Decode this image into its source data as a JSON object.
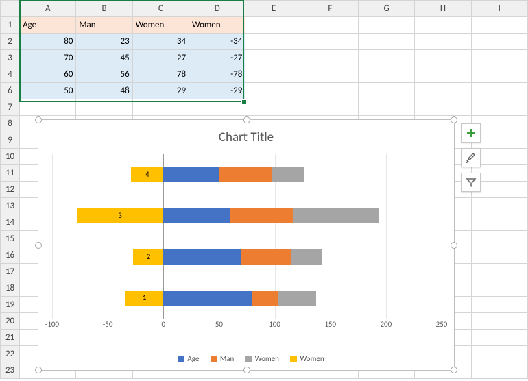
{
  "columns": [
    "A",
    "B",
    "C",
    "D",
    "E",
    "F",
    "G",
    "H",
    "I"
  ],
  "visible_rows": [
    "1",
    "2",
    "3",
    "4",
    "6",
    "7",
    "8",
    "9",
    "10",
    "11",
    "12",
    "13",
    "14",
    "15",
    "16",
    "17",
    "18",
    "19",
    "20",
    "21",
    "22",
    "23"
  ],
  "table": {
    "headers": [
      "Age",
      "Man",
      "Women",
      "Women"
    ],
    "rows": [
      {
        "r": "2",
        "v": [
          "80",
          "23",
          "34",
          "-34"
        ]
      },
      {
        "r": "3",
        "v": [
          "70",
          "45",
          "27",
          "-27"
        ]
      },
      {
        "r": "4",
        "v": [
          "60",
          "56",
          "78",
          "-78"
        ]
      },
      {
        "r": "6",
        "v": [
          "50",
          "48",
          "29",
          "-29"
        ]
      }
    ]
  },
  "chart": {
    "title": "Chart Title",
    "legend": [
      "Age",
      "Man",
      "Women",
      "Women"
    ]
  },
  "chart_data": {
    "type": "bar",
    "orientation": "horizontal",
    "stacked": true,
    "title": "Chart Title",
    "xlabel": "",
    "ylabel": "",
    "xlim": [
      -100,
      250
    ],
    "xticks": [
      -100,
      -50,
      0,
      50,
      100,
      150,
      200,
      250
    ],
    "categories": [
      "1",
      "2",
      "3",
      "4"
    ],
    "series": [
      {
        "name": "Age",
        "color": "#4472c4",
        "values": [
          80,
          70,
          60,
          50
        ]
      },
      {
        "name": "Man",
        "color": "#ed7d31",
        "values": [
          23,
          45,
          56,
          48
        ]
      },
      {
        "name": "Women",
        "color": "#a5a5a5",
        "values": [
          34,
          27,
          78,
          29
        ]
      },
      {
        "name": "Women",
        "color": "#ffc000",
        "values": [
          -34,
          -27,
          -78,
          -29
        ]
      }
    ]
  },
  "sidebuttons": [
    "plus",
    "brush",
    "filter"
  ]
}
